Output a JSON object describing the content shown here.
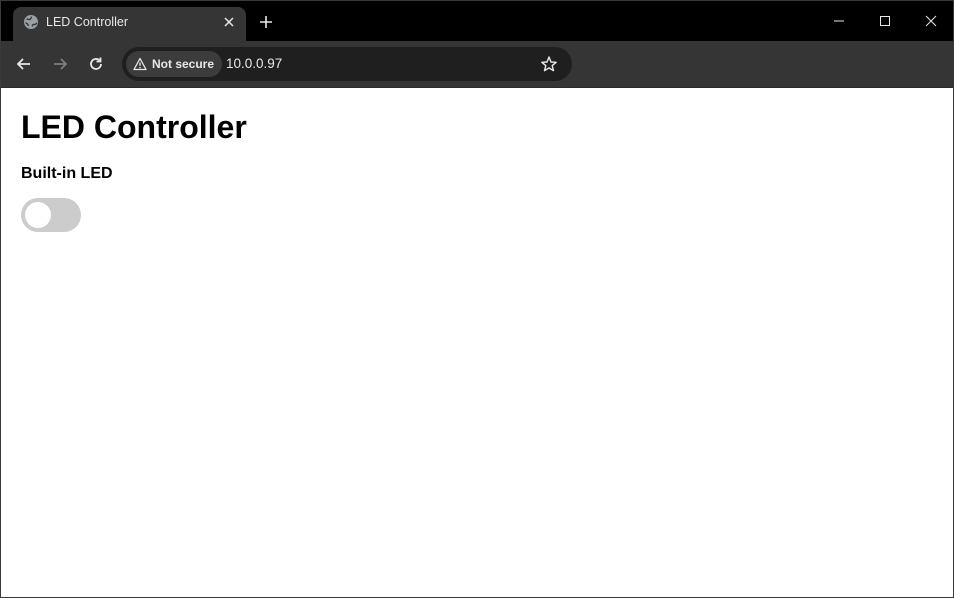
{
  "browser": {
    "tab": {
      "title": "LED Controller",
      "favicon": "globe-icon",
      "close_icon": "close-icon"
    },
    "new_tab_icon": "plus-icon",
    "window_controls": [
      "minimize-icon",
      "maximize-icon",
      "close-icon"
    ],
    "nav": {
      "back_icon": "arrow-left-icon",
      "forward_icon": "arrow-right-icon",
      "forward_enabled": false,
      "reload_icon": "reload-icon"
    },
    "omnibox": {
      "security_label": "Not secure",
      "security_icon": "warning-triangle-icon",
      "url": "10.0.0.97",
      "bookmark_icon": "star-icon"
    }
  },
  "page": {
    "title": "LED Controller",
    "led_label": "Built-in LED",
    "led_on": false
  },
  "colors": {
    "tabstrip_bg": "#000000",
    "toolbar_bg": "#353535",
    "omnibox_bg": "#1f1f1f",
    "toggle_off": "#cccccc",
    "page_bg": "#ffffff"
  }
}
